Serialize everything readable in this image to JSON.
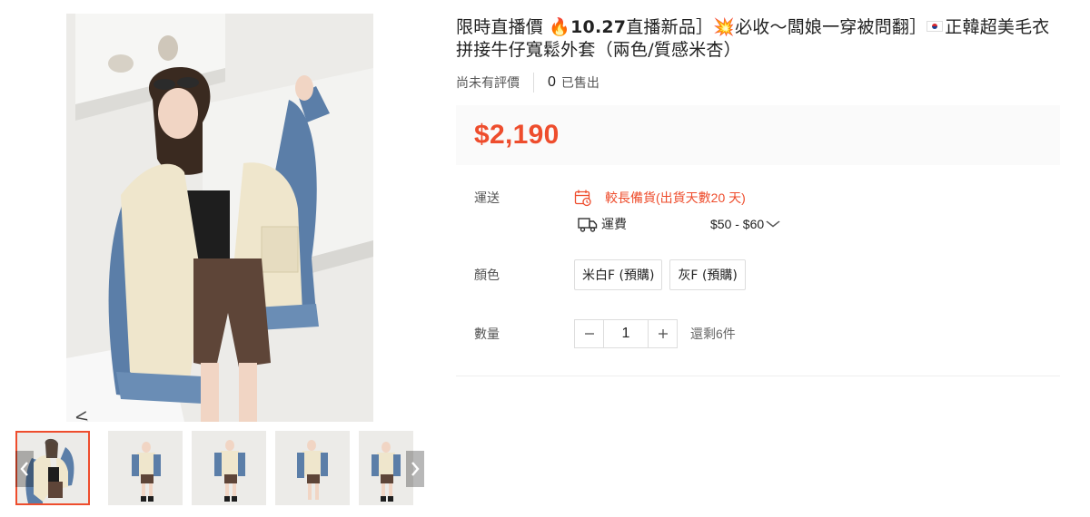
{
  "product": {
    "title_parts": {
      "prefix": "限時直播價 ",
      "fire": "🔥",
      "date": "10.27",
      "part1": "直播新品］",
      "boom": "💥",
      "part2": "必收〜闆娘一穿被問翻］",
      "part3": "正韓超美毛衣拼接牛仔寬鬆外套（兩色/質感米杏）"
    },
    "rating_text": "尚未有評價",
    "sold_count": "0",
    "sold_label": "已售出",
    "price": "$2,190"
  },
  "shipping": {
    "label": "運送",
    "delay_text": "較長備貨(出貨天數20 天)",
    "fee_label": "運費",
    "fee_range": "$50 - $60"
  },
  "variants": {
    "label": "顏色",
    "options": [
      "米白F (預購)",
      "灰F (預購)"
    ]
  },
  "quantity": {
    "label": "數量",
    "value": "1",
    "minus": "−",
    "plus": "+",
    "stock_text": "還剩6件"
  },
  "gallery": {
    "thumbnail_count": 5,
    "active_index": 0
  },
  "icons": {
    "prev": "chevron-left-icon",
    "next": "chevron-right-icon",
    "calendar": "calendar-clock-icon",
    "truck": "truck-icon",
    "dropdown": "chevron-down-icon"
  },
  "colors": {
    "accent": "#ee4d2d",
    "price_bg": "#fafafa",
    "denim": "#5b7ea8",
    "cream": "#efe6cc"
  }
}
